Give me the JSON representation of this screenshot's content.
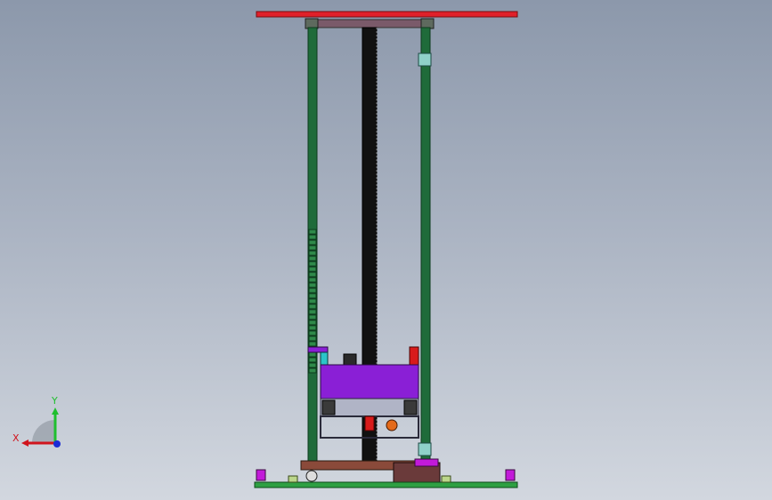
{
  "viewport": {
    "background_top": "#8c98ab",
    "background_bottom": "#d2d7df"
  },
  "model": {
    "colors": {
      "top_beam": "#e0202a",
      "mast": "#1f6b3a",
      "mast_edge": "#0d3b1d",
      "screw_shaft": "#111111",
      "carriage_panel": "#8a1fd6",
      "carriage_frame": "#4a4a5a",
      "base_rail": "#2ea043",
      "base_plate": "#8a4a3a",
      "accent_red": "#d81b1b",
      "accent_cyan": "#2bc4c8",
      "accent_magenta": "#c21ad9",
      "accent_orange": "#e46a1a"
    }
  },
  "triad": {
    "x_label": "X",
    "y_label": "Y",
    "x_color": "#d0141d",
    "y_color": "#1fbf2e",
    "z_color": "#1b2bd6"
  }
}
